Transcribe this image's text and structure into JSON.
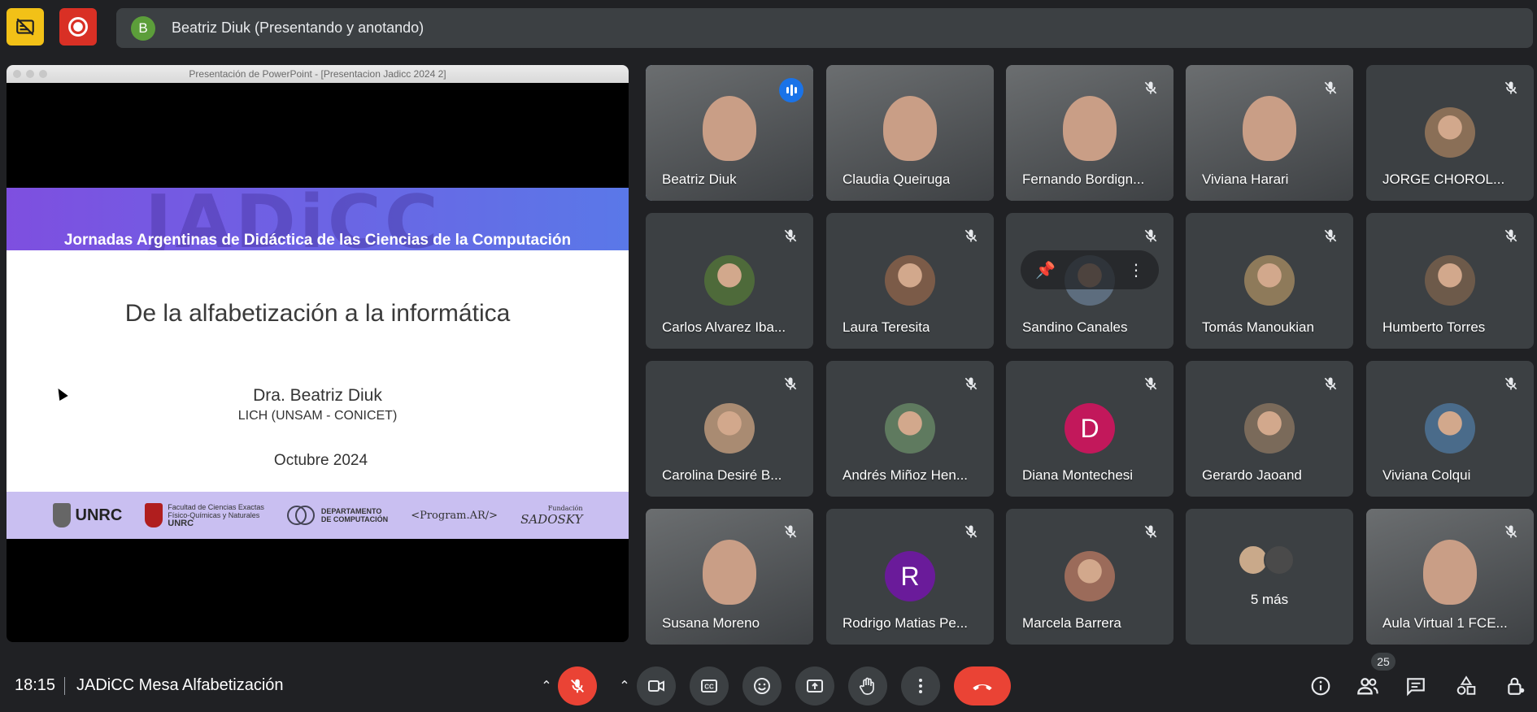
{
  "topbar": {
    "presenter_initial": "B",
    "presenter_label": "Beatriz Diuk (Presentando y anotando)"
  },
  "presentation": {
    "window_title": "Presentación de PowerPoint - [Presentacion Jadicc 2024 2]",
    "watermark": "JADiCC",
    "headline": "Jornadas Argentinas de Didáctica de las Ciencias de la Computación",
    "title": "De la alfabetización a la informática",
    "author": "Dra. Beatriz Diuk",
    "affiliation": "LICH (UNSAM - CONICET)",
    "date": "Octubre 2024",
    "logos": {
      "unrc": "UNRC",
      "facultad_line1": "Facultad de Ciencias Exactas",
      "facultad_line2": "Físico-Químicas y Naturales",
      "facultad_unrc": "UNRC",
      "depto_line1": "DEPARTAMENTO",
      "depto_line2": "DE COMPUTACIÓN",
      "program": "<Program.AR/>",
      "fundacion_small": "Fundación",
      "fundacion": "SADOSKY"
    }
  },
  "participants": [
    {
      "name": "Beatriz Diuk",
      "type": "video",
      "speaking": true
    },
    {
      "name": "Claudia Queiruga",
      "type": "video"
    },
    {
      "name": "Fernando Bordign...",
      "type": "video",
      "muted": true
    },
    {
      "name": "Viviana Harari",
      "type": "video",
      "muted": true
    },
    {
      "name": "JORGE CHOROL...",
      "type": "photo",
      "muted": true
    },
    {
      "name": "Carlos Alvarez Iba...",
      "type": "photo",
      "muted": true
    },
    {
      "name": "Laura Teresita",
      "type": "photo",
      "muted": true
    },
    {
      "name": "Sandino Canales",
      "type": "photo",
      "muted": true
    },
    {
      "name": "Tomás Manoukian",
      "type": "photo",
      "muted": true
    },
    {
      "name": "Humberto Torres",
      "type": "photo",
      "muted": true
    },
    {
      "name": "Carolina Desiré B...",
      "type": "photo",
      "muted": true
    },
    {
      "name": "Andrés Miñoz Hen...",
      "type": "photo",
      "muted": true
    },
    {
      "name": "Diana Montechesi",
      "type": "initial",
      "initial": "D",
      "color": "#c2185b",
      "muted": true
    },
    {
      "name": "Gerardo Jaoand",
      "type": "photo",
      "muted": true
    },
    {
      "name": "Viviana Colqui",
      "type": "photo",
      "muted": true
    },
    {
      "name": "Susana Moreno",
      "type": "video",
      "muted": true
    },
    {
      "name": "Rodrigo Matias Pe...",
      "type": "initial",
      "initial": "R",
      "color": "#6a1b9a",
      "muted": true
    },
    {
      "name": "Marcela Barrera",
      "type": "photo",
      "muted": true
    },
    {
      "name": "5 más",
      "type": "more"
    },
    {
      "name": "Aula Virtual 1 FCE...",
      "type": "video",
      "muted": true
    }
  ],
  "bottombar": {
    "time": "18:15",
    "meeting_name": "JADiCC Mesa Alfabetización",
    "participant_count": "25"
  },
  "colors": {
    "background": "#202124",
    "tile": "#3c4043",
    "accent": "#8ab4f8",
    "danger": "#ea4335",
    "record_yellow": "#f2c117"
  }
}
